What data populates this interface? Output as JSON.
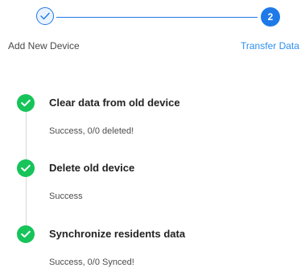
{
  "stepper": {
    "steps": [
      {
        "label": "Add New Device",
        "state": "completed",
        "icon": "check-icon"
      },
      {
        "label": "Transfer Data",
        "state": "active",
        "number": "2"
      }
    ],
    "colors": {
      "accent": "#1f7ae8",
      "label_active": "#2f8ef0",
      "label_done": "#4a4a4a"
    }
  },
  "tasks": [
    {
      "title": "Clear data from old device",
      "status": "Success, 0/0 deleted!",
      "icon": "check-circle-icon"
    },
    {
      "title": "Delete old device",
      "status": "Success",
      "icon": "check-circle-icon"
    },
    {
      "title": "Synchronize residents data",
      "status": "Success, 0/0 Synced!",
      "icon": "check-circle-icon"
    }
  ],
  "colors": {
    "success": "#16c45a",
    "timeline": "#d9d9d9"
  }
}
